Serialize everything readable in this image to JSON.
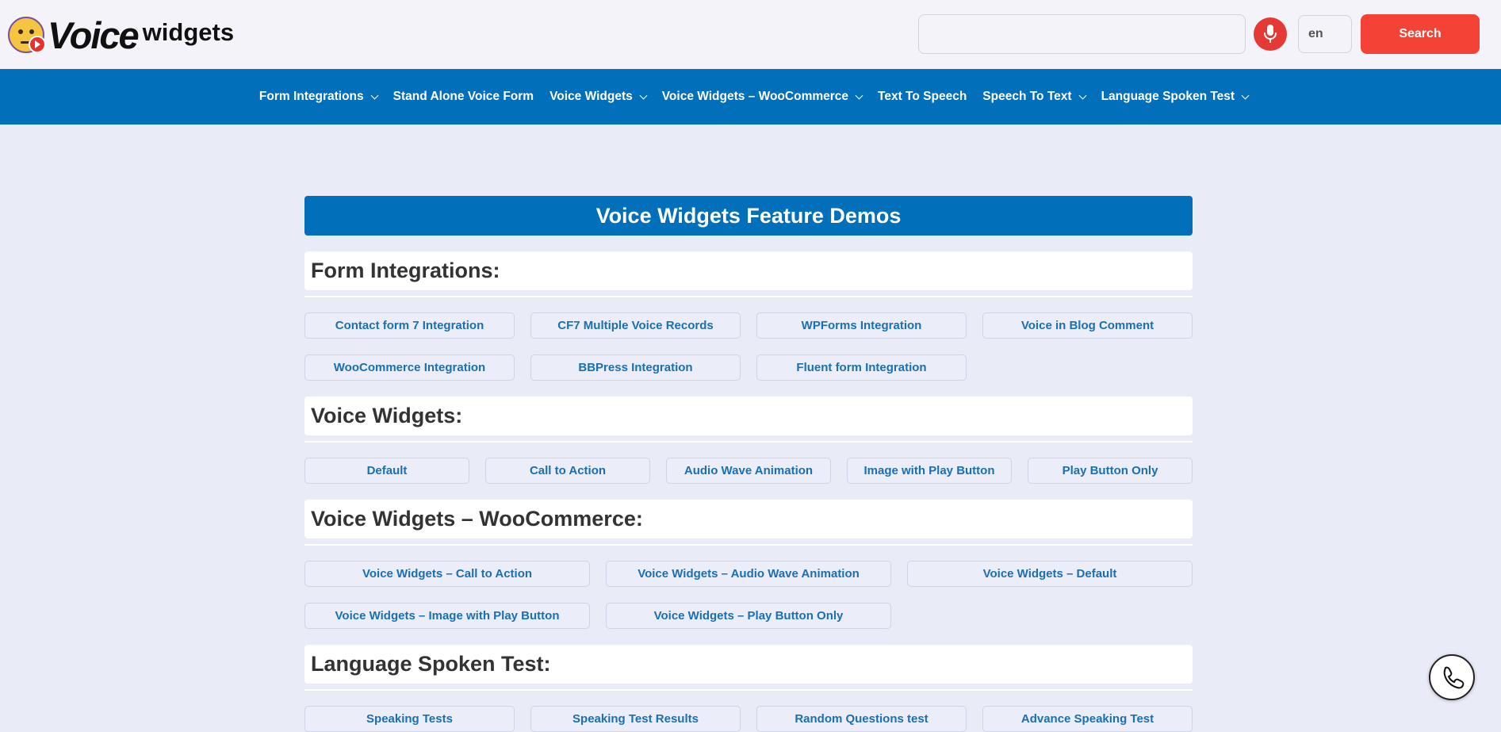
{
  "header": {
    "logo_icon": "thinking-face-play-icon",
    "logo_word_1": "Voice",
    "logo_word_2": "widgets",
    "search_value": "",
    "mic_icon": "microphone-icon",
    "language": "en",
    "search_button_label": "Search"
  },
  "nav": {
    "items": [
      {
        "label": "Form Integrations",
        "dropdown": true
      },
      {
        "label": "Stand Alone Voice Form",
        "dropdown": false
      },
      {
        "label": "Voice Widgets",
        "dropdown": true
      },
      {
        "label": "Voice Widgets – WooCommerce",
        "dropdown": true
      },
      {
        "label": "Text To Speech",
        "dropdown": false
      },
      {
        "label": "Speech To Text",
        "dropdown": true
      },
      {
        "label": "Language Spoken Test",
        "dropdown": true
      }
    ]
  },
  "main": {
    "banner_title": "Voice Widgets Feature Demos",
    "sections": [
      {
        "heading": "Form Integrations:",
        "buttons": [
          "Contact form 7 Integration",
          "CF7 Multiple Voice Records",
          "WPForms Integration",
          "Voice in Blog Comment",
          "WooCommerce Integration",
          "BBPress Integration",
          "Fluent form Integration"
        ]
      },
      {
        "heading": "Voice Widgets:",
        "buttons": [
          "Default",
          "Call to Action",
          "Audio Wave Animation",
          "Image with Play Button",
          "Play Button Only"
        ]
      },
      {
        "heading": "Voice Widgets – WooCommerce:",
        "buttons": [
          "Voice Widgets – Call to Action",
          "Voice Widgets – Audio Wave Animation",
          "Voice Widgets – Default",
          "Voice Widgets – Image with Play Button",
          "Voice Widgets – Play Button Only"
        ]
      },
      {
        "heading": "Language Spoken Test:",
        "buttons": [
          "Speaking Tests",
          "Speaking Test Results",
          "Random Questions test",
          "Advance Speaking Test"
        ]
      }
    ]
  },
  "floating": {
    "phone_icon": "phone-icon"
  },
  "colors": {
    "brand_blue": "#026fbb",
    "search_red": "#f44336",
    "mic_red": "#e53935",
    "page_bg": "#e9ebf7",
    "link_blue": "#1a6fb5"
  }
}
